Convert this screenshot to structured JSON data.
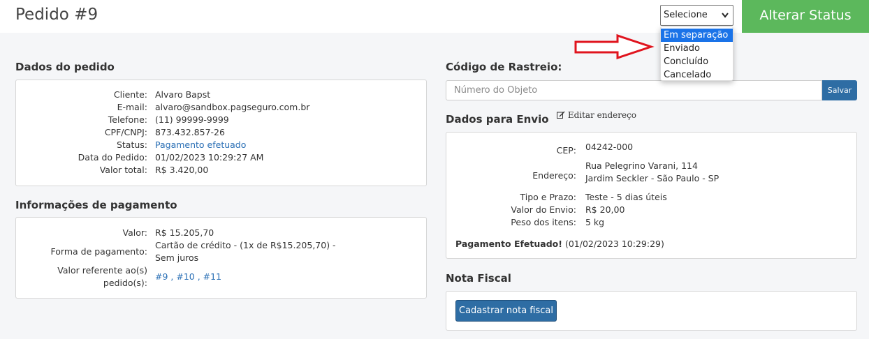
{
  "header": {
    "title": "Pedido #9",
    "select_value": "Selecione",
    "alter_button": "Alterar Status",
    "options": [
      "Em separação",
      "Enviado",
      "Concluído",
      "Cancelado"
    ]
  },
  "order": {
    "section_title": "Dados do pedido",
    "fields": [
      {
        "label": "Cliente:",
        "value": "Alvaro Bapst"
      },
      {
        "label": "E-mail:",
        "value": "alvaro@sandbox.pagseguro.com.br"
      },
      {
        "label": "Telefone:",
        "value": "(11) 99999-9999"
      },
      {
        "label": "CPF/CNPJ:",
        "value": "873.432.857-26"
      },
      {
        "label": "Status:",
        "value": "Pagamento efetuado"
      },
      {
        "label": "Data do Pedido:",
        "value": "01/02/2023 10:29:27 AM"
      },
      {
        "label": "Valor total:",
        "value": "R$ 3.420,00"
      }
    ]
  },
  "payment": {
    "section_title": "Informações de pagamento",
    "valor_label": "Valor:",
    "valor": "R$ 15.205,70",
    "forma_label": "Forma de pagamento:",
    "forma_line1": "Cartão de crédito - (1x de R$15.205,70) -",
    "forma_line2": "Sem juros",
    "ref_label_line1": "Valor referente ao(s)",
    "ref_label_line2": "pedido(s):",
    "ref_orders": "#9 , #10 , #11"
  },
  "tracking": {
    "section_title": "Código de Rastreio:",
    "placeholder": "Número do Objeto",
    "save_button": "Salvar"
  },
  "shipping": {
    "section_title": "Dados para Envio",
    "edit_label": "Editar endereço",
    "cep_label": "CEP:",
    "cep": "04242-000",
    "endereco_label": "Endereço:",
    "endereco_line1": "Rua Pelegrino Varani, 114",
    "endereco_line2": "Jardim Seckler - São Paulo - SP",
    "tipo_label": "Tipo e Prazo:",
    "tipo": "Teste - 5 dias úteis",
    "valor_envio_label": "Valor do Envio:",
    "valor_envio": "R$ 20,00",
    "peso_label": "Peso dos itens:",
    "peso": "5 kg",
    "payment_note_bold": "Pagamento Efetuado!",
    "payment_note_date": "(01/02/2023 10:29:29)"
  },
  "invoice": {
    "section_title": "Nota Fiscal",
    "button": "Cadastrar nota fiscal"
  },
  "colors": {
    "green": "#5cb85c",
    "blue_button": "#2e6da4",
    "link": "#2a6fb5",
    "arrow_red": "#e0141e",
    "selected_option": "#1a73e8"
  }
}
